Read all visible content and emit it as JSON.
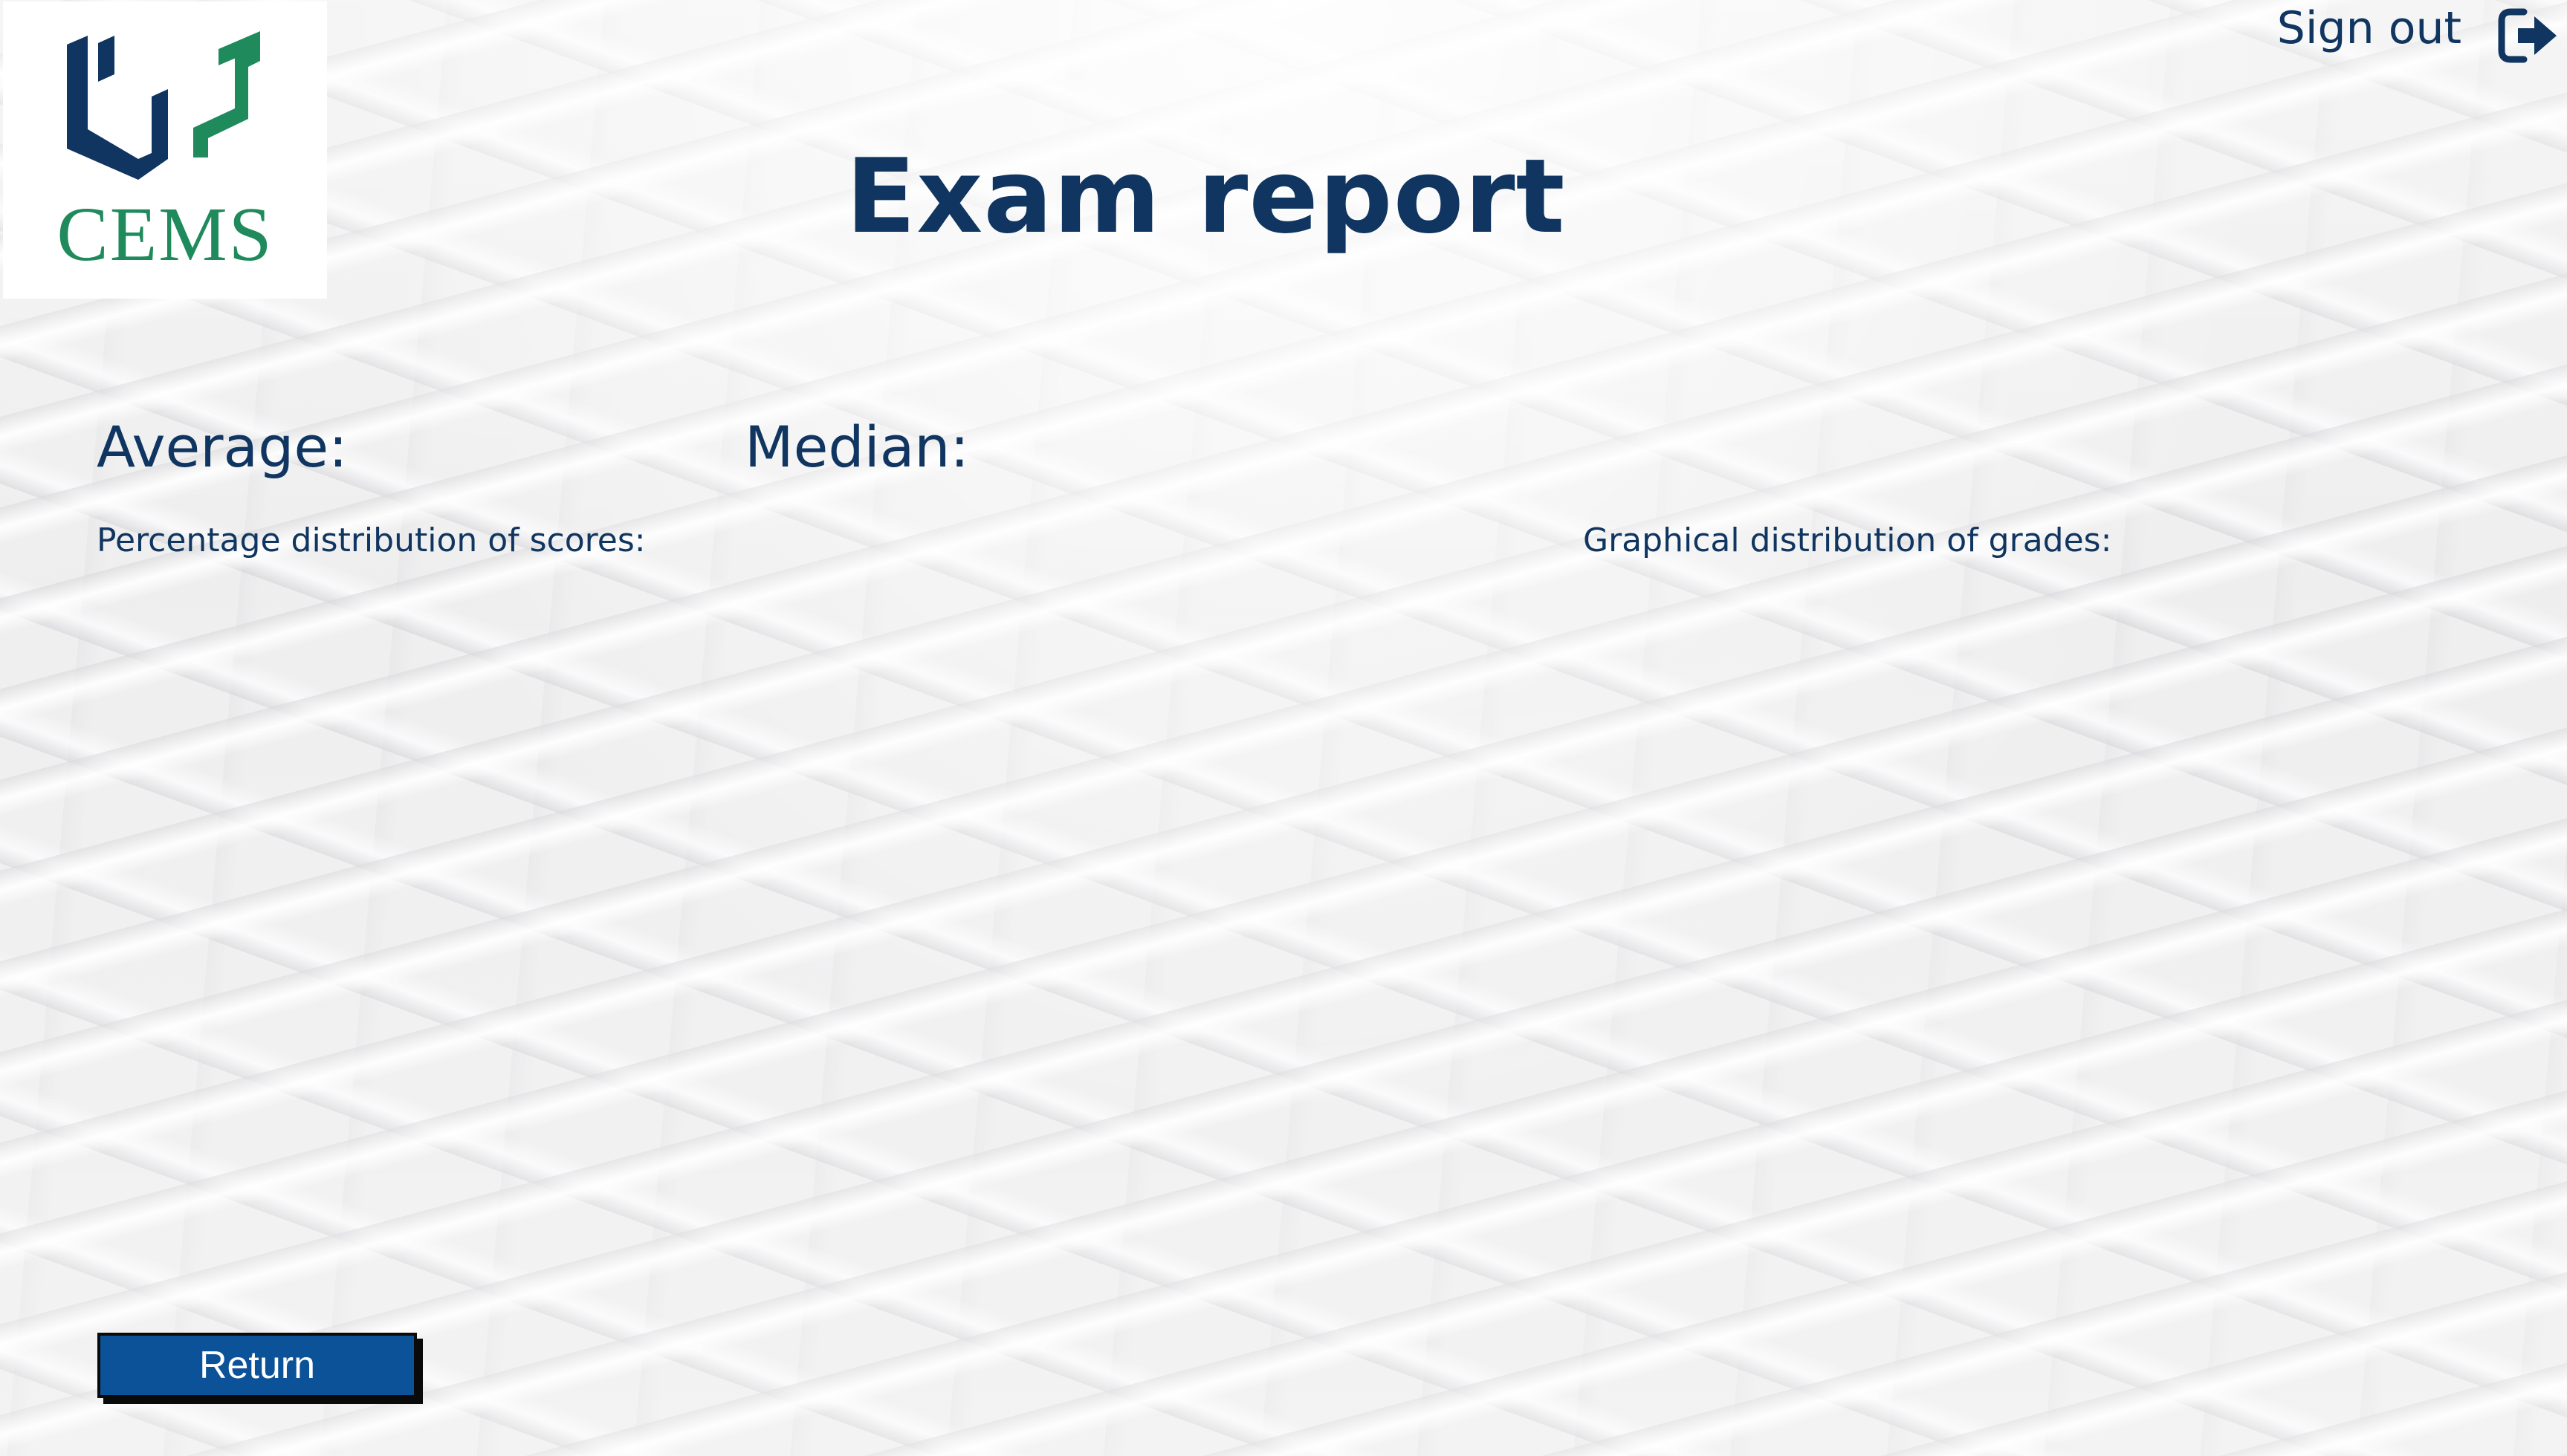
{
  "logo": {
    "text": "CEMS",
    "icon": "cems-logo-icon"
  },
  "header": {
    "signout_label": "Sign out",
    "signout_icon": "sign-out-icon"
  },
  "main": {
    "title": "Exam report",
    "average_label": "Average:",
    "median_label": "Median:",
    "scores_distribution_label": "Percentage distribution of scores:",
    "grades_distribution_label": "Graphical distribution of grades:"
  },
  "footer": {
    "return_label": "Return"
  },
  "colors": {
    "primary_text": "#0f3560",
    "button_bg": "#0c5298",
    "logo_green": "#1f8a5c",
    "logo_navy": "#0f3560"
  }
}
